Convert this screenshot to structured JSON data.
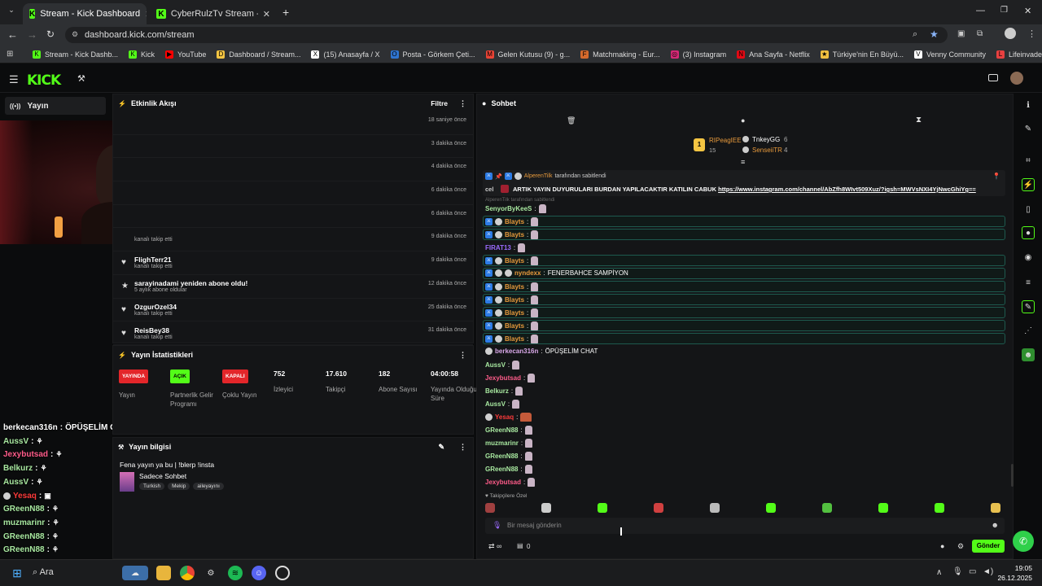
{
  "browser": {
    "tabs": [
      {
        "title": "Stream - Kick Dashboard",
        "close": "✕"
      },
      {
        "title": "CyberRulzTv Stream - Watch Liv",
        "close": "✕"
      }
    ],
    "url": "dashboard.kick.com/stream",
    "bookmarks": [
      {
        "label": "Stream - Kick Dashb...",
        "color": "#53fc18",
        "glyph": "K"
      },
      {
        "label": "Kick",
        "color": "#53fc18",
        "glyph": "K"
      },
      {
        "label": "YouTube",
        "color": "#ff0000",
        "glyph": "▶"
      },
      {
        "label": "Dashboard / Stream...",
        "color": "#f5c542",
        "glyph": "D"
      },
      {
        "label": "(15) Anasayfa / X",
        "color": "#ffffff",
        "glyph": "X"
      },
      {
        "label": "Posta - Görkem Çeti...",
        "color": "#2f74d0",
        "glyph": "O"
      },
      {
        "label": "Gelen Kutusu (9) - g...",
        "color": "#ea4335",
        "glyph": "M"
      },
      {
        "label": "Matchmaking - Eur...",
        "color": "#d46a2c",
        "glyph": "F"
      },
      {
        "label": "(3) Instagram",
        "color": "#d62976",
        "glyph": "◎"
      },
      {
        "label": "Ana Sayfa - Netflix",
        "color": "#e50914",
        "glyph": "N"
      },
      {
        "label": "Türkiye'nin En Büyü...",
        "color": "#f0c040",
        "glyph": "★"
      },
      {
        "label": "Venny Community",
        "color": "#ffffff",
        "glyph": "V"
      },
      {
        "label": "Lifeinvader - VennyV",
        "color": "#e84040",
        "glyph": "L"
      }
    ]
  },
  "nav": {
    "item": "Yayın"
  },
  "activity": {
    "title": "Etkinlik Akışı",
    "filter": "Filtre",
    "rows": [
      {
        "name": "",
        "sub": "",
        "time": "18 saniye önce"
      },
      {
        "name": "",
        "sub": "",
        "time": "3 dakika önce"
      },
      {
        "name": "",
        "sub": "",
        "time": "4 dakika önce"
      },
      {
        "name": "",
        "sub": "",
        "time": "6 dakika önce"
      },
      {
        "name": "",
        "sub": "",
        "time": "6 dakika önce"
      },
      {
        "name": "",
        "sub": "kanalı takip etti",
        "time": "9 dakika önce"
      },
      {
        "name": "FlighTerr21",
        "sub": "kanalı takip etti",
        "time": "9 dakika önce"
      },
      {
        "name": "sarayinadami yeniden abone oldu!",
        "sub": "5 aylık abone oldular",
        "time": "12 dakika önce"
      },
      {
        "name": "OzgurOzel34",
        "sub": "kanalı takip etti",
        "time": "25 dakika önce"
      },
      {
        "name": "ReisBey38",
        "sub": "kanalı takip etti",
        "time": "31 dakika önce"
      }
    ]
  },
  "stats": {
    "title": "Yayın İstatistikleri",
    "items": [
      {
        "badge": "YAYINDA",
        "label": "Yayın",
        "color": "#e3262a"
      },
      {
        "badge": "AÇIK",
        "label": "Partnerlik Gelir Programı",
        "color": "#53fc18"
      },
      {
        "badge": "KAPALI",
        "label": "Çoklu Yayın",
        "color": "#e3262a"
      },
      {
        "value": "752",
        "label": "İzleyici"
      },
      {
        "value": "17.610",
        "label": "Takipçi"
      },
      {
        "value": "182",
        "label": "Abone Sayısı"
      },
      {
        "value": "04:00:58",
        "label": "Yayında Olduğu Süre"
      }
    ]
  },
  "info": {
    "title": "Yayın bilgisi",
    "stream_title": "Fena yayın ya bu | !blerp !insta",
    "category": "Sadece Sohbet",
    "tags": [
      "Turkish",
      "Mekip",
      "aileyayını"
    ]
  },
  "chat": {
    "title": "Sohbet",
    "leaders": [
      {
        "name": "RIPeagIEE",
        "count": "15",
        "rank": "1"
      },
      {
        "name": "TnkeyGG",
        "count": "6"
      },
      {
        "name": "SenseiiTR",
        "count": "4"
      }
    ],
    "pinned_by": "AlperenTilk",
    "pinned_suffix": "tarafından sabitlendi",
    "pinned_prefix": "cel",
    "pinned_text": "ARTIK YAYIN DUYURULARI BURDAN YAPILACAKTIR KATILIN CABUK",
    "pinned_link": "https://www.instagram.com/channel/AbZfh8WIvt509Xuz/?igsh=MWVsNXI4YjNwcGhiYg==",
    "partial": "AlperenTilk tarafından sabitlendi",
    "messages": [
      {
        "user": "SenyorByKeeS",
        "color": "#a8e8a0",
        "text": "",
        "hl": false,
        "badges": 0
      },
      {
        "user": "Blayts",
        "color": "#e89a3c",
        "text": "",
        "hl": true,
        "badges": 2
      },
      {
        "user": "Blayts",
        "color": "#e89a3c",
        "text": "",
        "hl": true,
        "badges": 2
      },
      {
        "user": "FIRAT13",
        "color": "#9b6bff",
        "text": "",
        "hl": false,
        "badges": 0
      },
      {
        "user": "Blayts",
        "color": "#e89a3c",
        "text": "",
        "hl": true,
        "badges": 2
      },
      {
        "user": "nyndexx",
        "color": "#e89a3c",
        "text": "FENERBAHCE SAMPİYON",
        "hl": true,
        "badges": 3
      },
      {
        "user": "Blayts",
        "color": "#e89a3c",
        "text": "",
        "hl": true,
        "badges": 2
      },
      {
        "user": "Blayts",
        "color": "#e89a3c",
        "text": "",
        "hl": true,
        "badges": 2
      },
      {
        "user": "Blayts",
        "color": "#e89a3c",
        "text": "",
        "hl": true,
        "badges": 2
      },
      {
        "user": "Blayts",
        "color": "#e89a3c",
        "text": "",
        "hl": true,
        "badges": 2
      },
      {
        "user": "Blayts",
        "color": "#e89a3c",
        "text": "",
        "hl": true,
        "badges": 2
      },
      {
        "user": "berkecan316n",
        "color": "#d9a8e8",
        "text": "ÖPÜŞELİM CHAT",
        "hl": false,
        "badges": 1
      },
      {
        "user": "AussV",
        "color": "#a8e8a0",
        "text": "",
        "hl": false,
        "badges": 0
      },
      {
        "user": "Jexybutsad",
        "color": "#ff5c8a",
        "text": "",
        "hl": false,
        "badges": 0
      },
      {
        "user": "Belkurz",
        "color": "#a8e8a0",
        "text": "",
        "hl": false,
        "badges": 0
      },
      {
        "user": "AussV",
        "color": "#a8e8a0",
        "text": "",
        "hl": false,
        "badges": 0
      },
      {
        "user": "Yesaq",
        "color": "#ff3b3b",
        "text": "",
        "hl": false,
        "badges": 1
      },
      {
        "user": "GReenN88",
        "color": "#a8e8a0",
        "text": "",
        "hl": false,
        "badges": 0
      },
      {
        "user": "muzmarinr",
        "color": "#a8e8a0",
        "text": "",
        "hl": false,
        "badges": 0
      },
      {
        "user": "GReenN88",
        "color": "#a8e8a0",
        "text": "",
        "hl": false,
        "badges": 0
      },
      {
        "user": "GReenN88",
        "color": "#a8e8a0",
        "text": "",
        "hl": false,
        "badges": 0
      },
      {
        "user": "Jexybutsad",
        "color": "#ff5c8a",
        "text": "",
        "hl": false,
        "badges": 0
      }
    ],
    "emote_label": "Takipçilere Özel",
    "placeholder": "Bir mesaj gönderin",
    "send": "Gönder",
    "footer_count": "0"
  },
  "overlay": [
    {
      "user": "berkecan316n",
      "text": "ÖPÜŞELİM CHAT",
      "color": "#ffffff"
    },
    {
      "user": "AussV",
      "color": "#a8e8a0"
    },
    {
      "user": "Jexybutsad",
      "color": "#ff5c8a"
    },
    {
      "user": "Belkurz",
      "color": "#a8e8a0"
    },
    {
      "user": "AussV",
      "color": "#a8e8a0"
    },
    {
      "user": "Yesaq",
      "color": "#ff3b3b"
    },
    {
      "user": "GReenN88",
      "color": "#a8e8a0"
    },
    {
      "user": "muzmarinr",
      "color": "#a8e8a0"
    },
    {
      "user": "GReenN88",
      "color": "#a8e8a0"
    },
    {
      "user": "GReenN88",
      "color": "#a8e8a0"
    },
    {
      "user": "Jexybutsad",
      "color": "#ff5c8a"
    }
  ],
  "taskbar": {
    "search": "Ara",
    "time": "19:05",
    "date": "26.12.2025"
  },
  "colors": {
    "accent": "#53fc18"
  }
}
